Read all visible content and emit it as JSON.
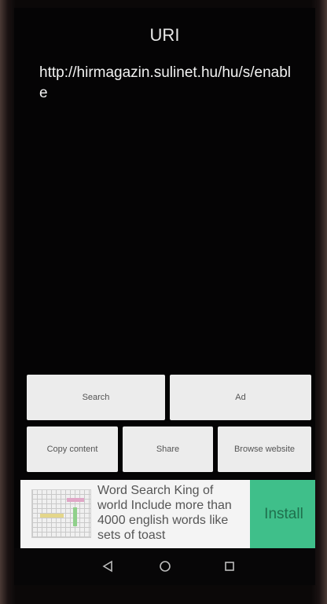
{
  "header": {
    "title": "URI"
  },
  "uri": {
    "value": "http://hirmagazin.sulinet.hu/hu/s/enable"
  },
  "actions": {
    "search": "Search",
    "ad": "Ad",
    "copy_content": "Copy content",
    "share": "Share",
    "browse_website": "Browse website"
  },
  "ad_banner": {
    "text": "Word Search King of world Include more than 4000 english words like sets of toast",
    "install_label": "Install"
  },
  "navbar": {
    "back_icon": "back-triangle-icon",
    "home_icon": "home-circle-icon",
    "recents_icon": "recents-square-icon"
  }
}
